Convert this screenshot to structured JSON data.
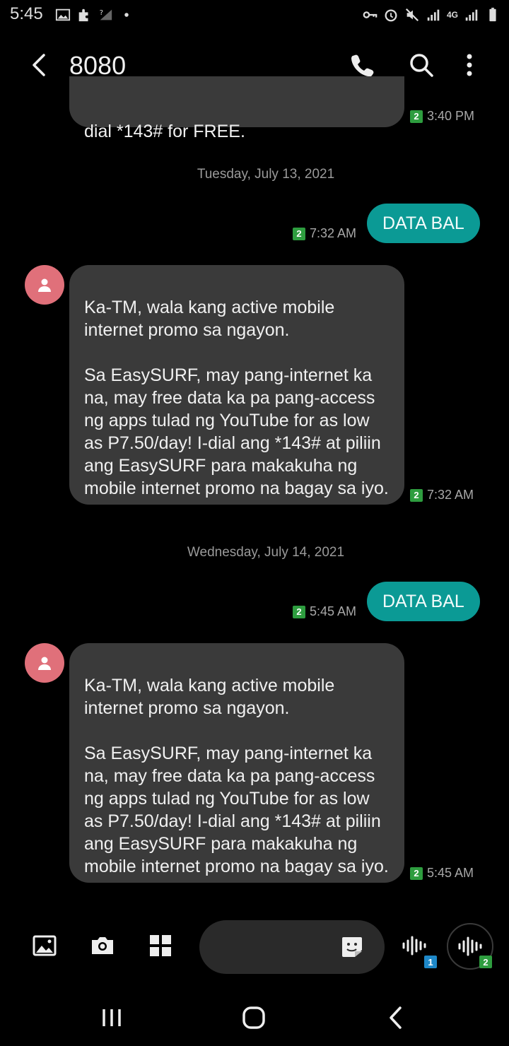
{
  "status_bar": {
    "time": "5:45",
    "left_icons": [
      "gallery-icon",
      "puzzle-icon",
      "no-signal-icon",
      "dot-icon"
    ],
    "right_icons": [
      "vpn-key-icon",
      "alarm-icon",
      "mute-icon",
      "signal-icon",
      "4g-icon",
      "signal-icon",
      "battery-icon"
    ],
    "network_label": "4G"
  },
  "header": {
    "title": "8080"
  },
  "messages": {
    "m0": {
      "text": "dial *143# for FREE.",
      "sim": "2",
      "time": "3:40 PM"
    },
    "date1": "Tuesday, July 13, 2021",
    "m1": {
      "text": "DATA BAL",
      "sim": "2",
      "time": "7:32 AM"
    },
    "m2": {
      "text": "Ka-TM, wala kang active mobile internet promo sa ngayon.\n\nSa EasySURF, may pang-internet ka na, may free data ka pa pang-access ng apps tulad ng YouTube for as low as P7.50/day! I-dial ang *143# at piliin ang EasySURF para makakuha ng mobile internet promo na bagay sa iyo.",
      "sim": "2",
      "time": "7:32 AM"
    },
    "date2": "Wednesday, July 14, 2021",
    "m3": {
      "text": "DATA BAL",
      "sim": "2",
      "time": "5:45 AM"
    },
    "m4": {
      "text": "Ka-TM, wala kang active mobile internet promo sa ngayon.\n\nSa EasySURF, may pang-internet ka na, may free data ka pa pang-access ng apps tulad ng YouTube for as low as P7.50/day! I-dial ang *143# at piliin ang EasySURF para makakuha ng mobile internet promo na bagay sa iyo.",
      "sim": "2",
      "time": "5:45 AM"
    }
  },
  "composer": {
    "voice_sim1": "1",
    "voice_sim2": "2"
  },
  "colors": {
    "outgoing_bubble": "#0b9a95",
    "incoming_bubble": "#3a3a3a",
    "sim_badge": "#2e9d3f",
    "avatar": "#e0707a",
    "sim1_tag": "#1e88c8"
  }
}
